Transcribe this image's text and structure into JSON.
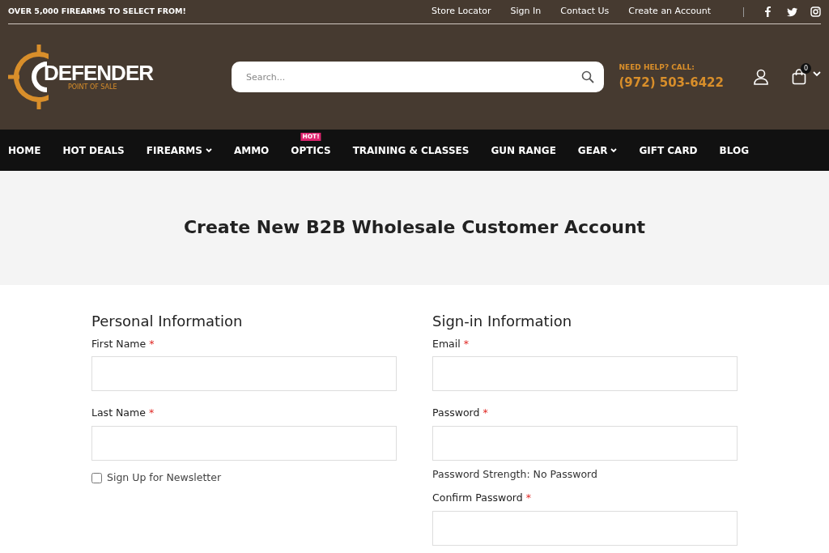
{
  "top_bar": {
    "promo": "OVER 5,000 FIREARMS TO SELECT FROM!",
    "links": [
      "Store Locator",
      "Sign In",
      "Contact Us",
      "Create an Account"
    ],
    "social": [
      {
        "kind": "facebook"
      },
      {
        "kind": "twitter"
      },
      {
        "kind": "instagram"
      }
    ]
  },
  "header": {
    "logo": {
      "name": "DEFENDER",
      "tagline": "POINT OF SALE"
    },
    "search": {
      "placeholder": "Search..."
    },
    "help": {
      "label": "NEED HELP? CALL:",
      "phone": "(972) 503-6422"
    },
    "cart_count": "0"
  },
  "nav": [
    {
      "label": "HOME",
      "dropdown": false
    },
    {
      "label": "HOT DEALS",
      "dropdown": false
    },
    {
      "label": "FIREARMS",
      "dropdown": true
    },
    {
      "label": "AMMO",
      "dropdown": false
    },
    {
      "label": "OPTICS",
      "dropdown": false,
      "badge": "HOT!"
    },
    {
      "label": "TRAINING & CLASSES",
      "dropdown": false
    },
    {
      "label": "GUN RANGE",
      "dropdown": false
    },
    {
      "label": "GEAR",
      "dropdown": true
    },
    {
      "label": "GIFT CARD",
      "dropdown": false
    },
    {
      "label": "BLOG",
      "dropdown": false
    }
  ],
  "page_title": "Create New B2B Wholesale Customer Account",
  "sections": [
    {
      "title": "Personal Information",
      "items": [
        {
          "kind": "field",
          "label": "First Name",
          "required_mark": "*"
        },
        {
          "kind": "field",
          "label": "Last Name",
          "required_mark": "*"
        },
        {
          "kind": "checkbox",
          "label": "Sign Up for Newsletter",
          "checked": false
        }
      ]
    },
    {
      "title": "Sign-in Information",
      "items": [
        {
          "kind": "field",
          "label": "Email",
          "required_mark": "*"
        },
        {
          "kind": "field",
          "label": "Password",
          "required_mark": "*",
          "note": "Password Strength: No Password"
        },
        {
          "kind": "field",
          "label": "Confirm Password",
          "required_mark": "*"
        }
      ]
    }
  ]
}
